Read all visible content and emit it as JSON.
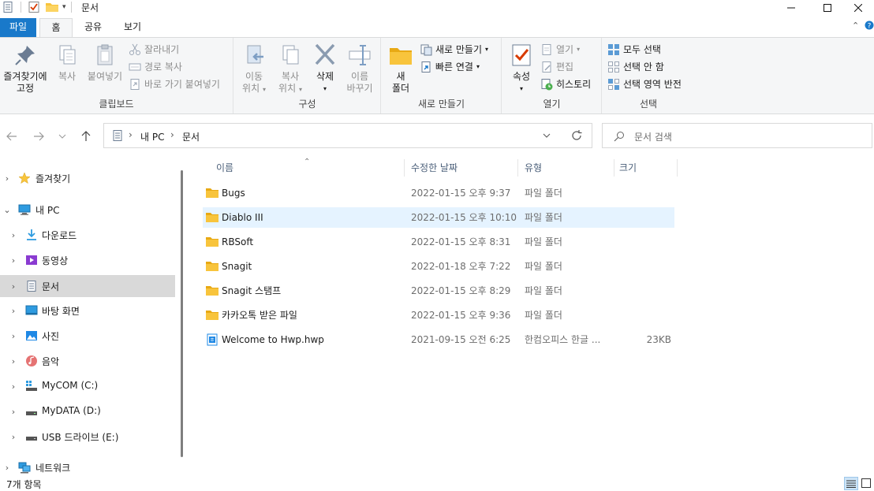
{
  "window": {
    "title": "문서"
  },
  "ribbon_tabs": [
    "파일",
    "홈",
    "공유",
    "보기"
  ],
  "ribbon": {
    "clipboard": {
      "label": "클립보드",
      "pin": "즐겨찾기에 고정",
      "pin_l1": "즐겨찾기에",
      "pin_l2": "고정",
      "copy": "복사",
      "paste": "붙여넣기",
      "cut": "잘라내기",
      "copy_path": "경로 복사",
      "paste_shortcut": "바로 가기 붙여넣기"
    },
    "organize": {
      "label": "구성",
      "move_l1": "이동",
      "move_l2": "위치",
      "copy_l1": "복사",
      "copy_l2": "위치",
      "delete": "삭제",
      "rename_l1": "이름",
      "rename_l2": "바꾸기"
    },
    "new": {
      "label": "새로 만들기",
      "folder_l1": "새",
      "folder_l2": "폴더",
      "new_item": "새로 만들기",
      "easy_access": "빠른 연결"
    },
    "open": {
      "label": "열기",
      "properties": "속성",
      "open": "열기",
      "edit": "편집",
      "history": "히스토리"
    },
    "select": {
      "label": "선택",
      "select_all": "모두 선택",
      "select_none": "선택 안 함",
      "invert": "선택 영역 반전"
    }
  },
  "address": {
    "crumbs": [
      "내 PC",
      "문서"
    ],
    "search_placeholder": "문서 검색"
  },
  "nav_tree": [
    {
      "label": "즐겨찾기",
      "icon": "star-icon"
    },
    {
      "label": "내 PC",
      "icon": "pc-icon"
    },
    {
      "label": "다운로드",
      "icon": "download-icon"
    },
    {
      "label": "동영상",
      "icon": "video-icon"
    },
    {
      "label": "문서",
      "icon": "document-icon"
    },
    {
      "label": "바탕 화면",
      "icon": "desktop-icon"
    },
    {
      "label": "사진",
      "icon": "picture-icon"
    },
    {
      "label": "음악",
      "icon": "music-icon"
    },
    {
      "label": "MyCOM (C:)",
      "icon": "drive-os-icon"
    },
    {
      "label": "MyDATA (D:)",
      "icon": "drive-icon"
    },
    {
      "label": "USB 드라이브 (E:)",
      "icon": "usb-drive-icon"
    },
    {
      "label": "네트워크",
      "icon": "network-icon"
    }
  ],
  "columns": [
    "이름",
    "수정한 날짜",
    "유형",
    "크기"
  ],
  "files": [
    {
      "name": "Bugs",
      "date": "2022-01-15 오후 9:37",
      "type": "파일 폴더",
      "size": ""
    },
    {
      "name": "Diablo III",
      "date": "2022-01-15 오후 10:10",
      "type": "파일 폴더",
      "size": ""
    },
    {
      "name": "RBSoft",
      "date": "2022-01-15 오후 8:31",
      "type": "파일 폴더",
      "size": ""
    },
    {
      "name": "Snagit",
      "date": "2022-01-18 오후 7:22",
      "type": "파일 폴더",
      "size": ""
    },
    {
      "name": "Snagit 스탬프",
      "date": "2022-01-15 오후 8:29",
      "type": "파일 폴더",
      "size": ""
    },
    {
      "name": "카카오톡 받은 파일",
      "date": "2022-01-15 오후 9:36",
      "type": "파일 폴더",
      "size": ""
    },
    {
      "name": "Welcome to Hwp.hwp",
      "date": "2021-09-15 오전 6:25",
      "type": "한컴오피스 한글 ...",
      "size": "23KB"
    }
  ],
  "status": {
    "count": "7개 항목"
  },
  "colors": {
    "file_tab": "#1979ca",
    "folder": "#f8c43c",
    "selection": "#e5f3ff",
    "header_text": "#4c607a"
  }
}
